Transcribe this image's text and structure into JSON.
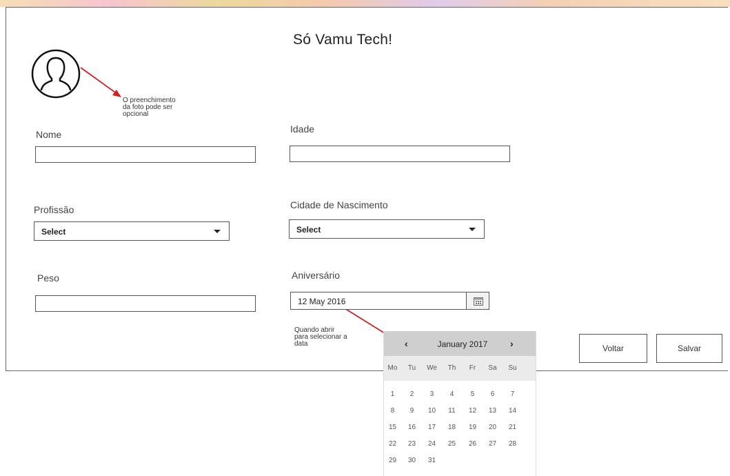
{
  "app": {
    "title": "Só Vamu Tech!"
  },
  "notes": {
    "photo_note": [
      "O preenchimento",
      "da foto pode ser",
      "opcional"
    ],
    "date_note": [
      "Quando abrir",
      "para selecionar a",
      "data"
    ]
  },
  "form": {
    "nome_label": "Nome",
    "idade_label": "Idade",
    "profissao_label": "Profissão",
    "profissao_value": "Select",
    "cidade_label": "Cidade de Nascimento",
    "cidade_value": "Select",
    "peso_label": "Peso",
    "aniversario_label": "Aniversário",
    "aniversario_value": "12 May 2016"
  },
  "buttons": {
    "voltar": "Voltar",
    "salvar": "Salvar"
  },
  "calendar": {
    "prev": "‹",
    "next": "›",
    "month_title": "January 2017",
    "weekdays": [
      "Mo",
      "Tu",
      "We",
      "Th",
      "Fr",
      "Sa",
      "Su"
    ],
    "weeks": [
      [
        "1",
        "2",
        "3",
        "4",
        "5",
        "6",
        "7"
      ],
      [
        "8",
        "9",
        "10",
        "11",
        "12",
        "13",
        "14"
      ],
      [
        "15",
        "16",
        "17",
        "18",
        "19",
        "20",
        "21"
      ],
      [
        "22",
        "23",
        "24",
        "25",
        "26",
        "27",
        "28"
      ],
      [
        "29",
        "30",
        "31"
      ]
    ]
  },
  "colors": {
    "annotation_arrow": "#d42020",
    "calendar_header": "#cfcfcf",
    "border": "#555555"
  },
  "icons": {
    "avatar": "user-outline-icon",
    "calendar": "calendar-icon",
    "dropdown": "caret-down-icon"
  }
}
